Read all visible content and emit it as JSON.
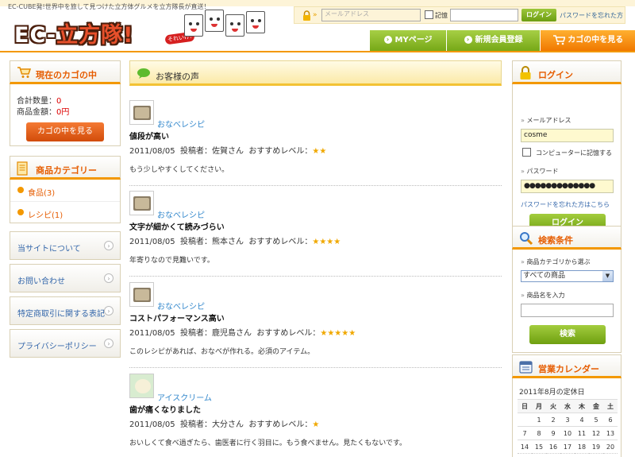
{
  "header": {
    "tagline": "EC-CUBE発!世界中を旅して見つけた立方体グルメを立方隊長が直送！",
    "logo_text_a": "EC-",
    "logo_text_b": "立方隊!",
    "logo_badge": "それいけ!",
    "login": {
      "email_placeholder": "メールアドレス",
      "remember_label": "記憶",
      "login_button": "ログイン",
      "forgot_link": "パスワードを忘れた方"
    },
    "nav": [
      {
        "label": "MYページ"
      },
      {
        "label": "新規会員登録"
      },
      {
        "label": "カゴの中を見る"
      }
    ]
  },
  "left": {
    "cart": {
      "title": "現在のカゴの中",
      "qty_label": "合計数量：",
      "qty_value": "0",
      "amount_label": "商品金額：",
      "amount_value": "0円",
      "button": "カゴの中を見る"
    },
    "categories": {
      "title": "商品カテゴリー",
      "items": [
        {
          "name": "食品",
          "count": "(3)"
        },
        {
          "name": "レシピ",
          "count": "(1)"
        }
      ]
    },
    "links": [
      {
        "label": "当サイトについて"
      },
      {
        "label": "お問い合わせ"
      },
      {
        "label": "特定商取引に関する表記"
      },
      {
        "label": "プライバシーポリシー"
      }
    ]
  },
  "main": {
    "title": "お客様の声",
    "reviews": [
      {
        "product": "おなべレシピ",
        "title": "値段が高い",
        "date": "2011/08/05",
        "poster": "投稿者：佐賀さん",
        "level_label": "おすすめレベル：",
        "stars": "★★",
        "body": "もう少しやすくしてください。"
      },
      {
        "product": "おなべレシピ",
        "title": "文字が細かくて読みづらい",
        "date": "2011/08/05",
        "poster": "投稿者：熊本さん",
        "level_label": "おすすめレベル：",
        "stars": "★★★★",
        "body": "年寄りなので見難いです。"
      },
      {
        "product": "おなべレシピ",
        "title": "コストパフォーマンス高い",
        "date": "2011/08/05",
        "poster": "投稿者：鹿児島さん",
        "level_label": "おすすめレベル：",
        "stars": "★★★★★",
        "body": "このレシピがあれば、おなべが作れる。必須のアイテム。"
      },
      {
        "product": "アイスクリーム",
        "title": "歯が痛くなりました",
        "date": "2011/08/05",
        "poster": "投稿者：大分さん",
        "level_label": "おすすめレベル：",
        "stars": "★",
        "body": "おいしくて食べ過ぎたら、歯医者に行く羽目に。もう食べません。見たくもないです。"
      }
    ]
  },
  "right": {
    "login": {
      "title": "ログイン",
      "email_label": "メールアドレス",
      "email_value": "cosme",
      "remember_label": "コンピューターに記憶する",
      "password_label": "パスワード",
      "password_value": "●●●●●●●●●●●●●",
      "forgot_link": "パスワードを忘れた方はこちら",
      "button": "ログイン"
    },
    "search": {
      "title": "検索条件",
      "category_label": "商品カテゴリから選ぶ",
      "category_value": "すべての商品",
      "name_label": "商品名を入力",
      "button": "検索"
    },
    "calendar": {
      "title": "営業カレンダー",
      "caption": "2011年8月の定休日",
      "weekdays": [
        "日",
        "月",
        "火",
        "水",
        "木",
        "金",
        "土"
      ],
      "weeks": [
        [
          "",
          "1",
          "2",
          "3",
          "4",
          "5",
          "6"
        ],
        [
          "7",
          "8",
          "9",
          "10",
          "11",
          "12",
          "13"
        ],
        [
          "14",
          "15",
          "16",
          "17",
          "18",
          "19",
          "20"
        ]
      ]
    }
  },
  "colors": {
    "accent_orange": "#f39800",
    "brand_green": "#76a817",
    "link_blue": "#3366aa",
    "star": "#f0a800"
  },
  "icons": [
    "lock-icon",
    "cart-icon",
    "folder-icon",
    "speech-bubble-icon",
    "padlock-icon",
    "magnifier-icon",
    "calendar-icon",
    "chevron-right-icon",
    "dropdown-arrow-icon",
    "checkbox-icon"
  ]
}
